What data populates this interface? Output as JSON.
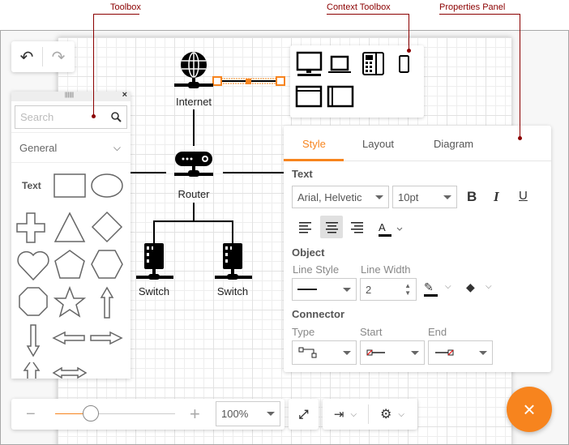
{
  "annotations": {
    "toolbox": "Toolbox",
    "context_toolbox": "Context Toolbox",
    "properties_panel": "Properties Panel"
  },
  "history": {
    "undo_icon": "undo-icon",
    "redo_icon": "redo-icon"
  },
  "toolbox": {
    "search_placeholder": "Search",
    "category": "General",
    "text_shape": "Text",
    "shapes": [
      "rectangle",
      "ellipse",
      "cross",
      "triangle",
      "diamond",
      "heart",
      "pentagon",
      "hexagon",
      "octagon",
      "star",
      "arrow-up",
      "arrow-down",
      "arrow-left",
      "arrow-right",
      "arrow-up-down",
      "arrow-left-right"
    ]
  },
  "context_toolbox": {
    "items": [
      "desktop",
      "laptop",
      "phone",
      "mobile",
      "window",
      "panel"
    ]
  },
  "diagram": {
    "nodes": [
      {
        "label": "Internet",
        "icon": "globe"
      },
      {
        "label": "Router",
        "icon": "router"
      },
      {
        "label": "Switch",
        "icon": "switch"
      },
      {
        "label": "Switch",
        "icon": "switch"
      }
    ]
  },
  "properties": {
    "tabs": [
      "Style",
      "Layout",
      "Diagram"
    ],
    "active_tab": "Style",
    "text_section": "Text",
    "font_family": "Arial, Helvetic",
    "font_size": "10pt",
    "object_section": "Object",
    "line_style_label": "Line Style",
    "line_width_label": "Line Width",
    "line_width": "2",
    "connector_section": "Connector",
    "type_label": "Type",
    "start_label": "Start",
    "end_label": "End"
  },
  "zoom": {
    "value": "100%",
    "level": 0.3
  },
  "colors": {
    "accent": "#f7841e",
    "annotation": "#8b0000"
  }
}
